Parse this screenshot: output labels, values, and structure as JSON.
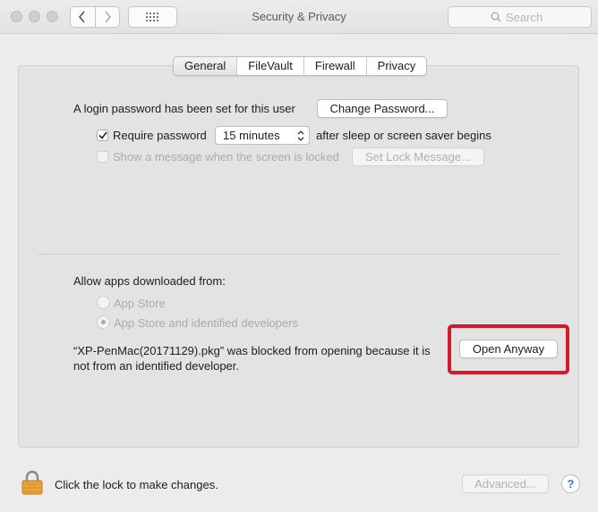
{
  "window": {
    "title": "Security & Privacy"
  },
  "toolbar": {
    "search_placeholder": "Search"
  },
  "tabs": [
    {
      "label": "General",
      "active": true
    },
    {
      "label": "FileVault",
      "active": false
    },
    {
      "label": "Firewall",
      "active": false
    },
    {
      "label": "Privacy",
      "active": false
    }
  ],
  "general": {
    "login_password_text": "A login password has been set for this user",
    "change_password_label": "Change Password...",
    "require_password": {
      "label": "Require password",
      "checked": true
    },
    "require_password_delay": "15 minutes",
    "require_password_suffix": "after sleep or screen saver begins",
    "show_message": {
      "label": "Show a message when the screen is locked",
      "checked": false
    },
    "set_lock_message_label": "Set Lock Message..."
  },
  "allow_apps": {
    "heading": "Allow apps downloaded from:",
    "options": [
      {
        "label": "App Store",
        "selected": false
      },
      {
        "label": "App Store and identified developers",
        "selected": true
      }
    ],
    "blocked_message": "“XP-PenMac(20171129).pkg” was blocked from opening because it is not from an identified developer.",
    "open_anyway_label": "Open Anyway"
  },
  "footer": {
    "lock_text": "Click the lock to make changes.",
    "advanced_label": "Advanced...",
    "help_label": "?"
  },
  "colors": {
    "highlight": "#d3192a",
    "lock": "#e8a33c",
    "help": "#3478f6"
  },
  "icons": [
    "back-chevron-icon",
    "forward-chevron-icon",
    "grid-icon",
    "search-icon",
    "checkmark-icon",
    "select-chevron-icon",
    "lock-icon",
    "help-icon"
  ]
}
